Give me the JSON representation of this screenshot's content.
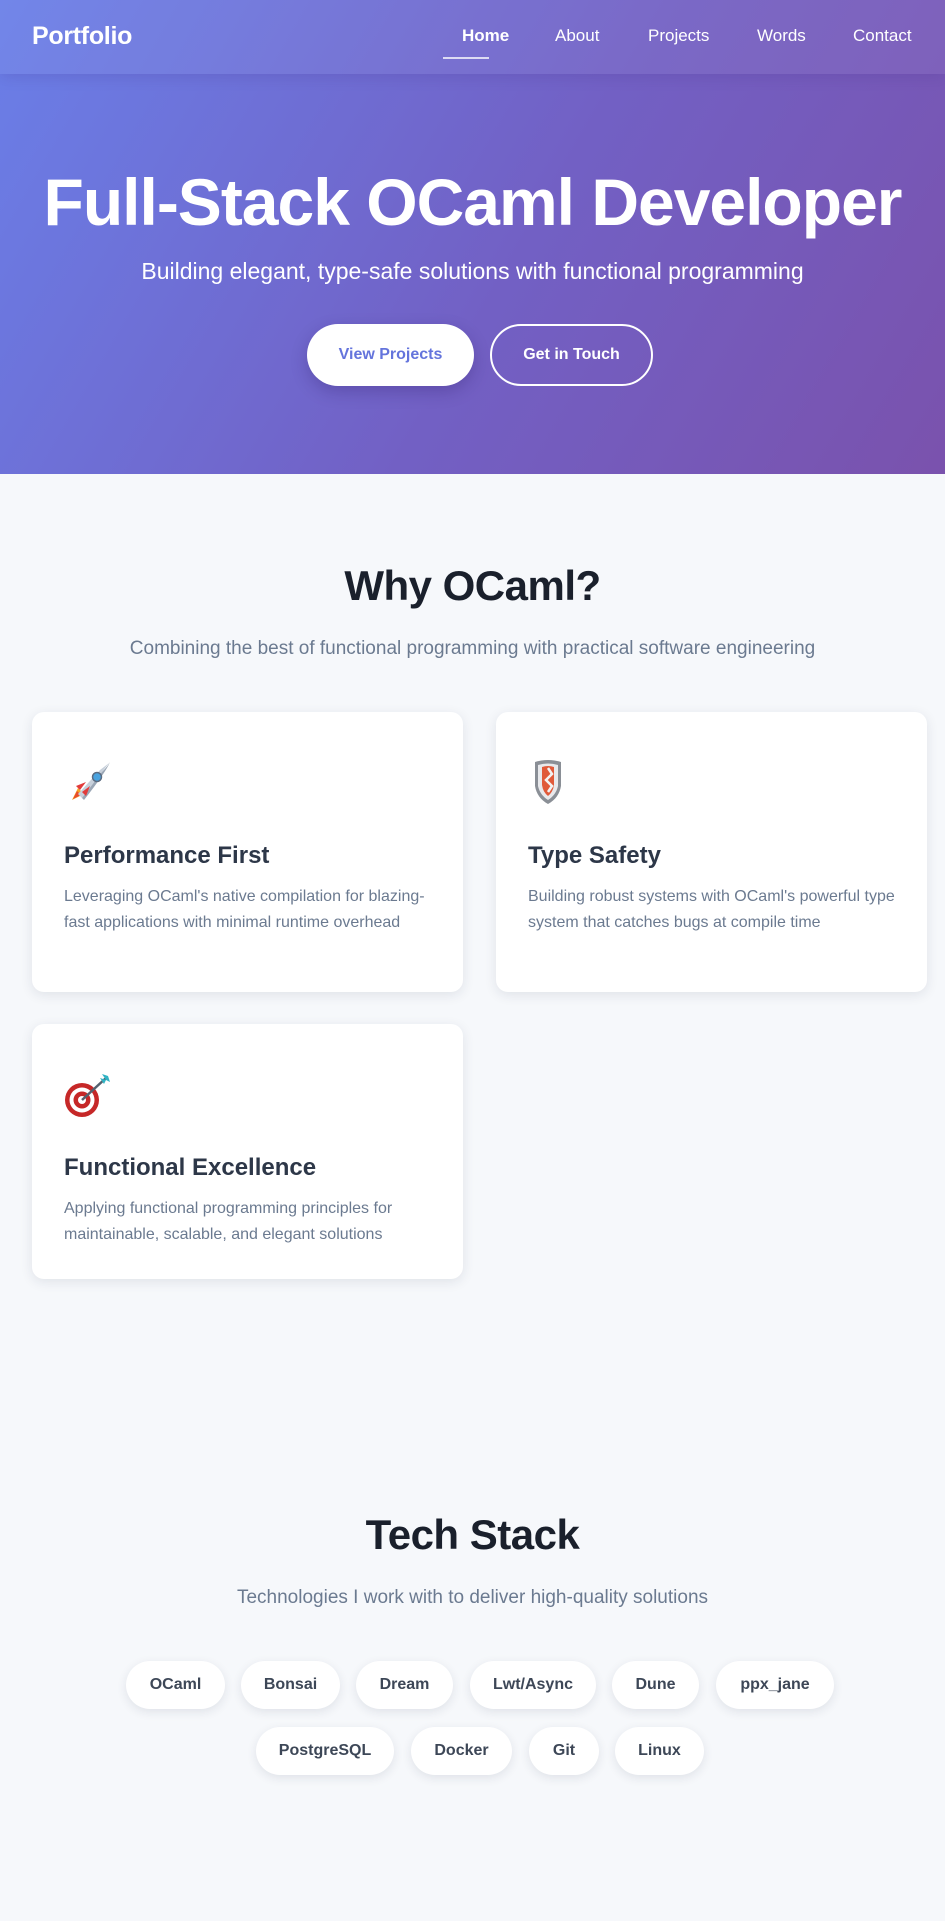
{
  "nav": {
    "brand": "Portfolio",
    "links": [
      "Home",
      "About",
      "Projects",
      "Words",
      "Contact"
    ],
    "active": "Home"
  },
  "hero": {
    "title": "Full-Stack OCaml Developer",
    "subtitle": "Building elegant, type-safe solutions with functional programming",
    "primary_button": "View Projects",
    "secondary_button": "Get in Touch"
  },
  "why": {
    "title": "Why OCaml?",
    "subtitle": "Combining the best of functional programming with practical software engineering",
    "cards": [
      {
        "icon": "rocket-icon",
        "title": "Performance First",
        "description": "Leveraging OCaml's native compilation for blazing-fast applications with minimal runtime overhead"
      },
      {
        "icon": "shield-icon",
        "title": "Type Safety",
        "description": "Building robust systems with OCaml's powerful type system that catches bugs at compile time"
      },
      {
        "icon": "target-icon",
        "title": "Functional Excellence",
        "description": "Applying functional programming principles for maintainable, scalable, and elegant solutions"
      }
    ]
  },
  "tech": {
    "title": "Tech Stack",
    "subtitle": "Technologies I work with to deliver high-quality solutions",
    "items": [
      "OCaml",
      "Bonsai",
      "Dream",
      "Lwt/Async",
      "Dune",
      "ppx_jane",
      "PostgreSQL",
      "Docker",
      "Git",
      "Linux"
    ]
  }
}
